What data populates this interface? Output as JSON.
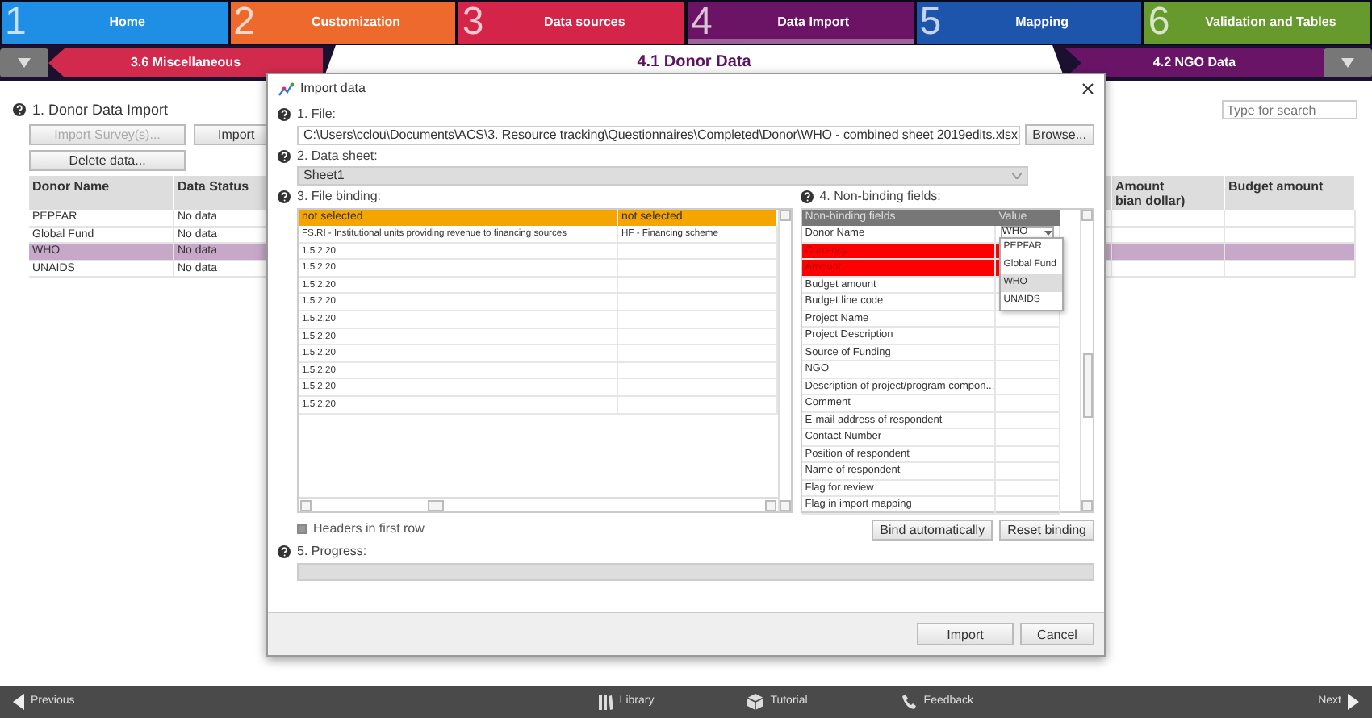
{
  "steps": [
    {
      "number": "1",
      "label": "Home",
      "color": "#1f8fe6",
      "selected": false
    },
    {
      "number": "2",
      "label": "Customization",
      "color": "#ee6a2c",
      "selected": false
    },
    {
      "number": "3",
      "label": "Data sources",
      "color": "#d42448",
      "selected": false
    },
    {
      "number": "4",
      "label": "Data Import",
      "color": "#6b1466",
      "selected": true
    },
    {
      "number": "5",
      "label": "Mapping",
      "color": "#1d55ad",
      "selected": false
    },
    {
      "number": "6",
      "label": "Validation and Tables",
      "color": "#679a2c",
      "selected": false
    }
  ],
  "subnav": {
    "previous": "3.6 Miscellaneous",
    "current": "4.1 Donor Data",
    "next": "4.2 NGO Data"
  },
  "page": {
    "section": "1. Donor Data Import",
    "search": {
      "placeholder": "Type for search"
    },
    "buttons": [
      {
        "label": "Import Survey(s)...",
        "disabled": true
      },
      {
        "label": "Import",
        "disabled": false
      },
      {
        "label": "Delete data...",
        "disabled": false
      }
    ],
    "table": {
      "columns": [
        {
          "label": "Donor Name"
        },
        {
          "label": "Data Status"
        },
        {
          "label": "Amount",
          "sub": "bian dollar)"
        },
        {
          "label": "Budget amount"
        }
      ],
      "rows": [
        {
          "cells": [
            "PEPFAR",
            "No data"
          ],
          "selected": false
        },
        {
          "cells": [
            "Global Fund",
            "No data"
          ],
          "selected": false
        },
        {
          "cells": [
            "WHO",
            "No data"
          ],
          "selected": true
        },
        {
          "cells": [
            "UNAIDS",
            "No data"
          ],
          "selected": false
        }
      ]
    }
  },
  "dialog": {
    "title": "Import data",
    "file": {
      "label": "1. File:",
      "value": "C:\\Users\\cclou\\Documents\\ACS\\3. Resource tracking\\Questionnaires\\Completed\\Donor\\WHO - combined sheet 2019edits.xlsx",
      "button": "Browse..."
    },
    "sheet": {
      "label": "2. Data sheet:",
      "value": "Sheet1"
    },
    "binding": {
      "label": "3. File binding:",
      "columns": [
        "not selected",
        "not selected"
      ],
      "rows": [
        [
          "FS.RI - Institutional units providing revenue to financing sources",
          "HF - Financing scheme"
        ],
        [
          "1.5.2.20"
        ],
        [
          "1.5.2.20"
        ],
        [
          "1.5.2.20"
        ],
        [
          "1.5.2.20"
        ],
        [
          "1.5.2.20"
        ],
        [
          "1.5.2.20"
        ],
        [
          "1.5.2.20"
        ],
        [
          "1.5.2.20"
        ],
        [
          "1.5.2.20"
        ],
        [
          "1.5.2.20"
        ]
      ]
    },
    "headers_first_row": {
      "label": "Headers in first row",
      "checked": false
    },
    "nonbinding": {
      "label": "4. Non-binding fields:",
      "columns": [
        "Non-binding fields",
        "Value"
      ],
      "rows": [
        {
          "name": "Donor Name",
          "value": "WHO",
          "required": false
        },
        {
          "name": "Currency",
          "required": true
        },
        {
          "name": "Amount",
          "required": true
        },
        {
          "name": "Budget amount",
          "required": false
        },
        {
          "name": "Budget line code",
          "required": false
        },
        {
          "name": "Project Name",
          "required": false
        },
        {
          "name": "Project Description",
          "required": false
        },
        {
          "name": "Source of Funding",
          "required": false
        },
        {
          "name": "NGO",
          "required": false
        },
        {
          "name": "Description of project/program compon...",
          "required": false
        },
        {
          "name": "Comment",
          "required": false
        },
        {
          "name": "E-mail address of respondent",
          "required": false
        },
        {
          "name": "Contact Number",
          "required": false
        },
        {
          "name": "Position of respondent",
          "required": false
        },
        {
          "name": "Name of respondent",
          "required": false
        },
        {
          "name": "Flag for review",
          "required": false
        },
        {
          "name": "Flag in import mapping",
          "required": false
        }
      ],
      "dropdown": [
        {
          "label": "PEPFAR",
          "selected": false
        },
        {
          "label": "Global Fund",
          "selected": false
        },
        {
          "label": "WHO",
          "selected": true
        },
        {
          "label": "UNAIDS",
          "selected": false
        }
      ],
      "buttons": [
        "Bind automatically",
        "Reset binding"
      ]
    },
    "progress": {
      "label": "5. Progress:",
      "level": 0
    },
    "buttons": [
      "Import",
      "Cancel"
    ]
  },
  "footer": {
    "previous": "Previous",
    "library": "Library",
    "tutorial": "Tutorial",
    "feedback": "Feedback",
    "next": "Next"
  }
}
